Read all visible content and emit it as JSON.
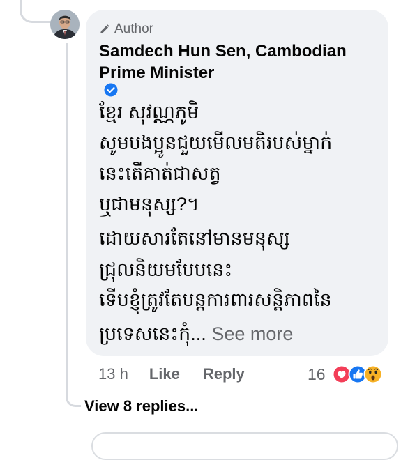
{
  "comment": {
    "badge": "Author",
    "author_name": "Samdech Hun Sen, Cambodian Prime Minister",
    "lines": [
      "ខ្មែរ សុវណ្ណភូមិ",
      "សូមបងប្អូនជួយមើលមតិរបស់ម្នាក់",
      "នេះតើគាត់ជាសត្វ",
      "ឬជាមនុស្ស?។",
      "ដោយសារតែនៅមានមនុស្ស",
      "ជ្រុលនិយមបែបនេះ",
      "ទើបខ្ញុំត្រូវតែបន្តការពារសន្តិភាពនៃ",
      "ប្រទេសនេះកុំ..."
    ],
    "see_more": "See more"
  },
  "actions": {
    "time": "13 h",
    "like": "Like",
    "reply": "Reply",
    "reaction_count": "16"
  },
  "replies": {
    "view_label": "View 8 replies..."
  },
  "icons": {
    "badge": "pencil-icon",
    "verified": "verified-badge-icon",
    "reactions": [
      "love-reaction-icon",
      "like-reaction-icon",
      "wow-reaction-icon"
    ]
  },
  "colors": {
    "bubble": "#f0f2f5",
    "secondary_text": "#65676b",
    "verified": "#1877f2",
    "love": "#f33e58",
    "like": "#1877f2",
    "wow": "#f7b125"
  }
}
